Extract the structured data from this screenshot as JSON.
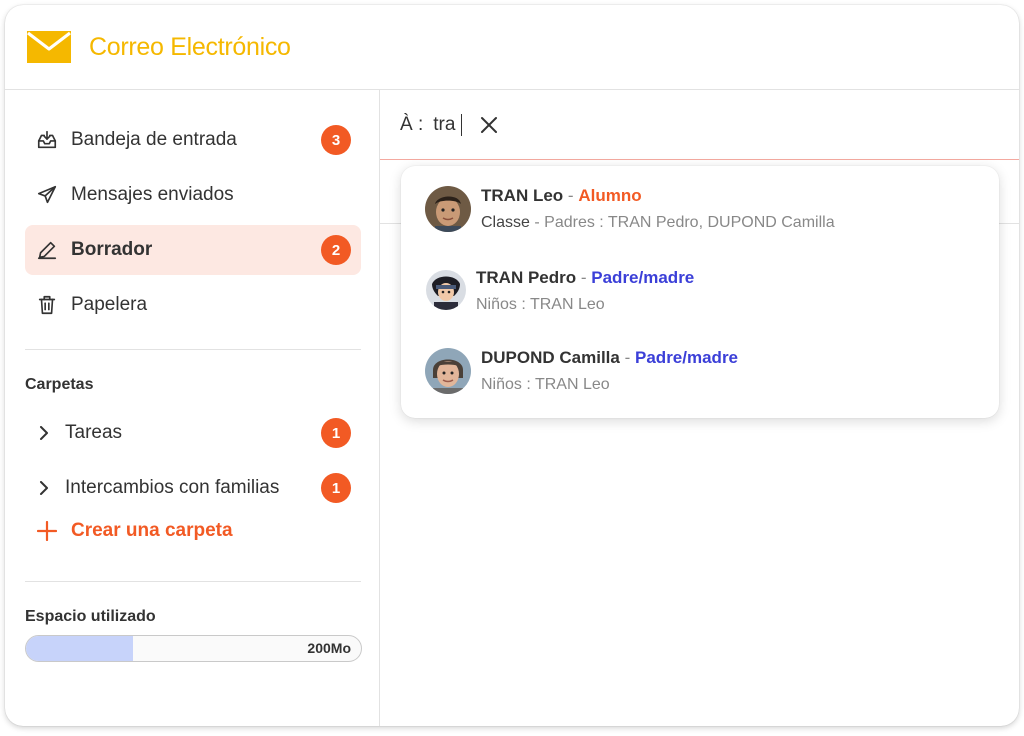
{
  "header": {
    "title": "Correo Electrónico",
    "logo_icon": "envelope-icon",
    "brand_color": "#f5b800"
  },
  "sidebar": {
    "nav": [
      {
        "label": "Bandeja de entrada",
        "icon": "inbox-icon",
        "badge": "3"
      },
      {
        "label": "Mensajes enviados",
        "icon": "send-icon",
        "badge": ""
      },
      {
        "label": "Borrador",
        "icon": "pencil-icon",
        "badge": "2",
        "active": true
      },
      {
        "label": "Papelera",
        "icon": "trash-icon",
        "badge": ""
      }
    ],
    "folders_title": "Carpetas",
    "folders": [
      {
        "label": "Tareas",
        "badge": "1"
      },
      {
        "label": "Intercambios con familias",
        "badge": "1"
      }
    ],
    "create_folder_label": "Crear una carpeta",
    "storage": {
      "title": "Espacio utilizado",
      "label": "200Mo",
      "used_fraction": 0.32
    }
  },
  "compose": {
    "to_label": "À :",
    "to_value": "tra"
  },
  "suggestions": [
    {
      "name": "TRAN Leo",
      "separator": "-",
      "role": "Alumno",
      "role_type": "student",
      "detail_prefix": "Classe",
      "detail_sep": "-",
      "detail": "Padres : TRAN Pedro, DUPOND Camilla"
    },
    {
      "name": "TRAN Pedro",
      "separator": "-",
      "role": "Padre/madre",
      "role_type": "parent",
      "detail": "Niños : TRAN Leo"
    },
    {
      "name": "DUPOND Camilla",
      "separator": "-",
      "role": "Padre/madre",
      "role_type": "parent",
      "detail": "Niños : TRAN Leo"
    }
  ],
  "colors": {
    "accent": "#f25a24",
    "parent_role": "#3b3fd8",
    "active_bg": "#fde8e2",
    "storage_fill": "#c7d3fa"
  }
}
